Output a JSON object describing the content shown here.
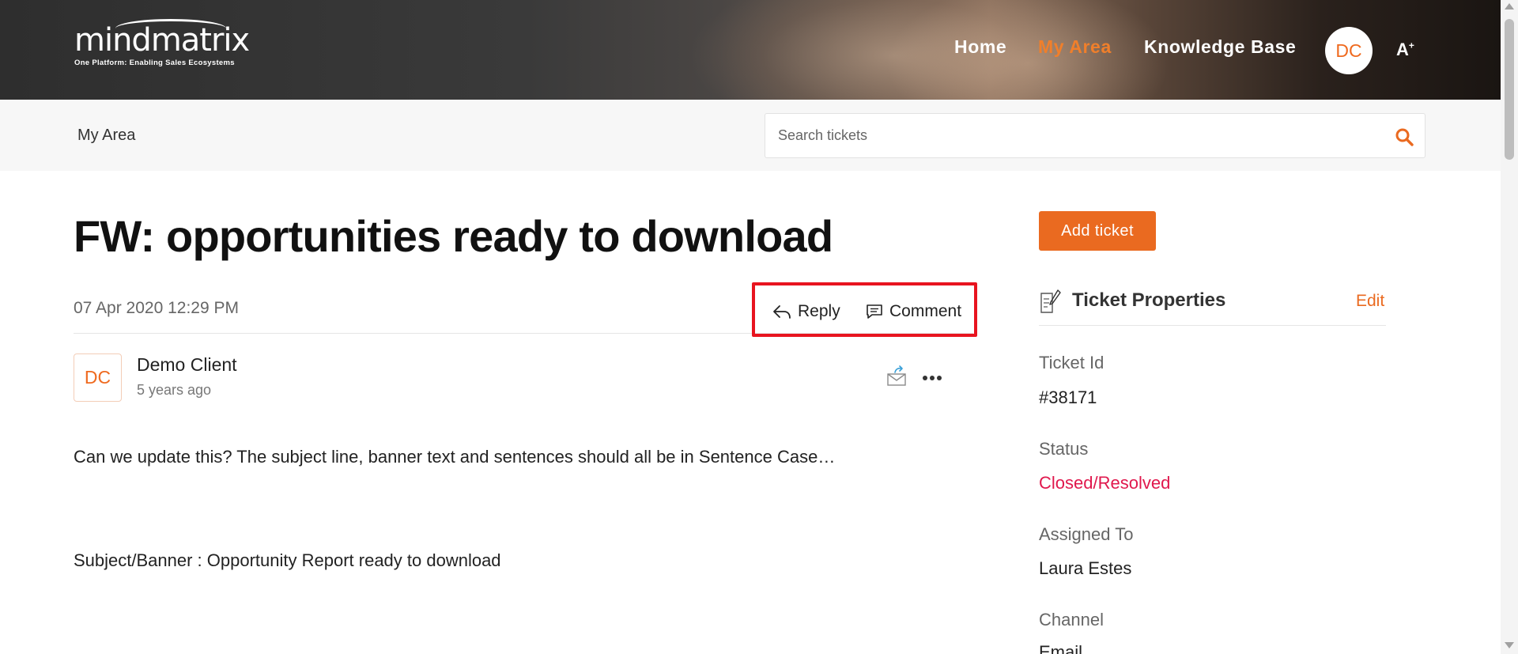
{
  "header": {
    "logo_text": "mindmatrix",
    "logo_tagline": "One Platform: Enabling Sales Ecosystems",
    "nav": [
      {
        "label": "Home",
        "active": false
      },
      {
        "label": "My Area",
        "active": true
      },
      {
        "label": "Knowledge Base",
        "active": false
      }
    ],
    "avatar_initials": "DC",
    "font_toggle_label": "A",
    "font_toggle_sup": "+",
    "accent_color": "#f07f2b"
  },
  "subbar": {
    "breadcrumb": "My Area",
    "search_placeholder": "Search tickets"
  },
  "ticket": {
    "title": "FW: opportunities ready to download",
    "date": "07 Apr 2020 12:29 PM",
    "actions": {
      "reply_label": "Reply",
      "comment_label": "Comment"
    },
    "message": {
      "avatar_initials": "DC",
      "sender": "Demo Client",
      "time_ago": "5 years ago",
      "icons": [
        "mail-forward-icon",
        "more-options-icon"
      ],
      "lines": [
        "Can we update this? The subject line, banner text and sentences should all be in Sentence Case…",
        "Subject/Banner : Opportunity Report ready to download"
      ]
    }
  },
  "sidebar": {
    "add_ticket_label": "Add ticket",
    "properties_title": "Ticket Properties",
    "edit_label": "Edit",
    "properties": [
      {
        "label": "Ticket Id",
        "value": "#38171"
      },
      {
        "label": "Status",
        "value": "Closed/Resolved",
        "status_color": "#e0184d"
      },
      {
        "label": "Assigned To",
        "value": "Laura Estes"
      },
      {
        "label": "Channel",
        "value": "Email"
      }
    ]
  },
  "highlight_color": "#e8141f"
}
